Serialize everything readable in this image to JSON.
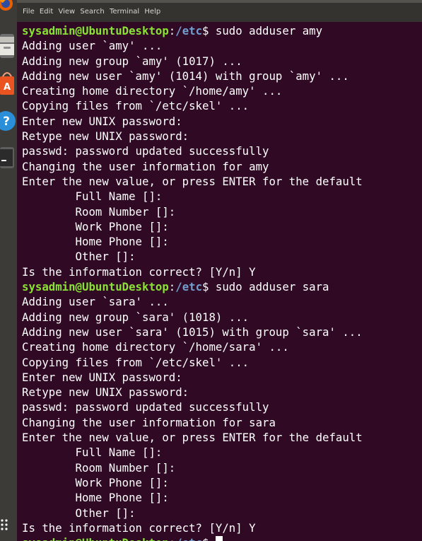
{
  "launcher": {
    "items": [
      {
        "name": "firefox-icon"
      },
      {
        "name": "files-icon"
      },
      {
        "name": "software-center-icon"
      },
      {
        "name": "help-icon"
      },
      {
        "name": "terminal-icon"
      },
      {
        "name": "apps-grid-icon"
      }
    ]
  },
  "menubar": {
    "items": [
      "File",
      "Edit",
      "View",
      "Search",
      "Terminal",
      "Help"
    ]
  },
  "prompt": {
    "user_host": "sysadmin@UbuntuDesktop",
    "colon": ":",
    "path": "/etc",
    "symbol": "$ "
  },
  "terminal": {
    "lines": [
      {
        "kind": "cmd",
        "text": "sudo adduser amy"
      },
      {
        "kind": "out",
        "text": "Adding user `amy' ..."
      },
      {
        "kind": "out",
        "text": "Adding new group `amy' (1017) ..."
      },
      {
        "kind": "out",
        "text": "Adding new user `amy' (1014) with group `amy' ..."
      },
      {
        "kind": "out",
        "text": "Creating home directory `/home/amy' ..."
      },
      {
        "kind": "out",
        "text": "Copying files from `/etc/skel' ..."
      },
      {
        "kind": "out",
        "text": "Enter new UNIX password:"
      },
      {
        "kind": "out",
        "text": "Retype new UNIX password:"
      },
      {
        "kind": "out",
        "text": "passwd: password updated successfully"
      },
      {
        "kind": "out",
        "text": "Changing the user information for amy"
      },
      {
        "kind": "out",
        "text": "Enter the new value, or press ENTER for the default"
      },
      {
        "kind": "out",
        "text": "        Full Name []:"
      },
      {
        "kind": "out",
        "text": "        Room Number []:"
      },
      {
        "kind": "out",
        "text": "        Work Phone []:"
      },
      {
        "kind": "out",
        "text": "        Home Phone []:"
      },
      {
        "kind": "out",
        "text": "        Other []:"
      },
      {
        "kind": "out",
        "text": "Is the information correct? [Y/n] Y"
      },
      {
        "kind": "cmd",
        "text": "sudo adduser sara"
      },
      {
        "kind": "out",
        "text": "Adding user `sara' ..."
      },
      {
        "kind": "out",
        "text": "Adding new group `sara' (1018) ..."
      },
      {
        "kind": "out",
        "text": "Adding new user `sara' (1015) with group `sara' ..."
      },
      {
        "kind": "out",
        "text": "Creating home directory `/home/sara' ..."
      },
      {
        "kind": "out",
        "text": "Copying files from `/etc/skel' ..."
      },
      {
        "kind": "out",
        "text": "Enter new UNIX password:"
      },
      {
        "kind": "out",
        "text": "Retype new UNIX password:"
      },
      {
        "kind": "out",
        "text": "passwd: password updated successfully"
      },
      {
        "kind": "out",
        "text": "Changing the user information for sara"
      },
      {
        "kind": "out",
        "text": "Enter the new value, or press ENTER for the default"
      },
      {
        "kind": "out",
        "text": "        Full Name []:"
      },
      {
        "kind": "out",
        "text": "        Room Number []:"
      },
      {
        "kind": "out",
        "text": "        Work Phone []:"
      },
      {
        "kind": "out",
        "text": "        Home Phone []:"
      },
      {
        "kind": "out",
        "text": "        Other []:"
      },
      {
        "kind": "out",
        "text": "Is the information correct? [Y/n] Y"
      },
      {
        "kind": "cmd",
        "text": "",
        "cursor": true
      }
    ]
  },
  "colors": {
    "terminal_bg": "#300a24",
    "prompt_user": "#8ae234",
    "prompt_path": "#729fcf",
    "text": "#ffffff"
  }
}
